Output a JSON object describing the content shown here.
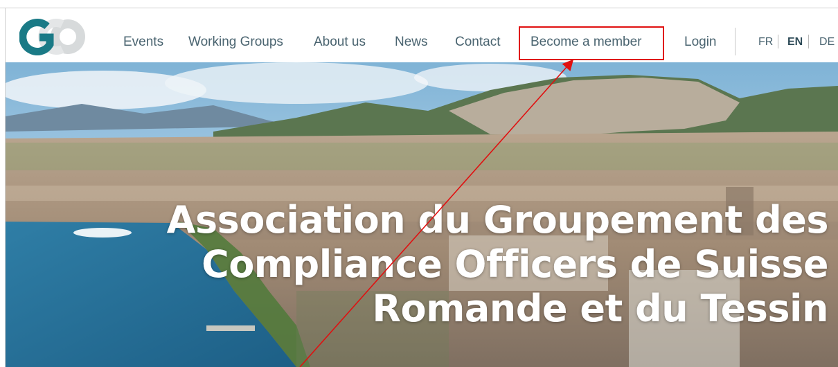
{
  "logo": {
    "text": "GCO",
    "icon": "gco-logo"
  },
  "nav": {
    "items": [
      {
        "label": "Events"
      },
      {
        "label": "Working Groups"
      },
      {
        "label": "About us"
      },
      {
        "label": "News"
      },
      {
        "label": "Contact"
      },
      {
        "label": "Become a member"
      },
      {
        "label": "Login"
      }
    ]
  },
  "languages": [
    {
      "code": "FR",
      "active": false
    },
    {
      "code": "EN",
      "active": true
    },
    {
      "code": "DE",
      "active": false
    }
  ],
  "hero": {
    "headline": [
      "Association du Groupement des",
      "Compliance Officers de Suisse",
      "Romande et du Tessin"
    ],
    "image": "geneva-city-aerial-photo"
  },
  "annotation": {
    "highlight": "Become a member",
    "color": "#e01010"
  }
}
